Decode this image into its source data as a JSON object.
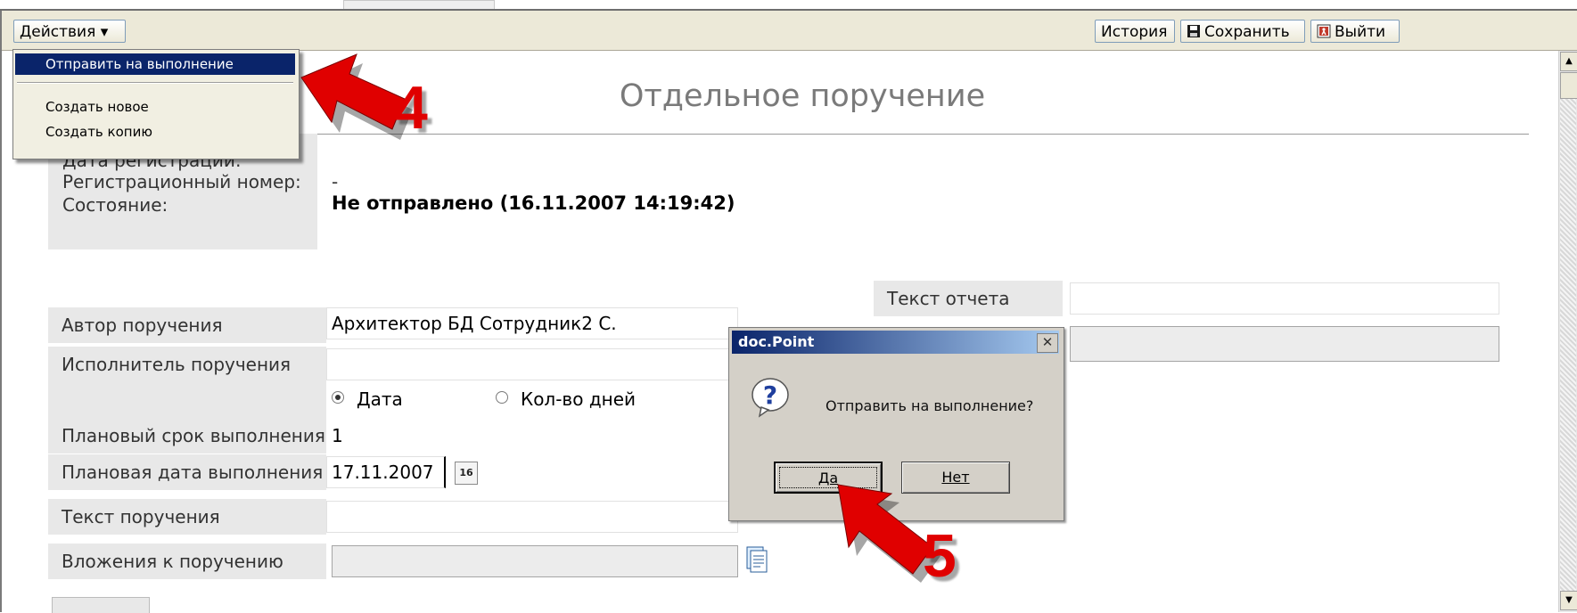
{
  "toolbar": {
    "actions_label": "Действия ▾",
    "history_label": "История",
    "save_label": "Сохранить",
    "exit_label": "Выйти"
  },
  "actions_menu": {
    "items": [
      "Отправить на выполнение",
      "Создать новое",
      "Создать копию"
    ]
  },
  "page": {
    "title": "Отдельное поручение"
  },
  "registration": {
    "date_label": "Дата регистрации:",
    "number_label": "Регистрационный номер:",
    "number_value": "-",
    "status_label": "Состояние:",
    "status_value": "Не отправлено (16.11.2007 14:19:42)"
  },
  "form": {
    "author_label": "Автор поручения",
    "author_value": "Архитектор БД Сотрудник2 С.",
    "executor_label": "Исполнитель поручения",
    "executor_value": "",
    "radio_date_label": "Дата",
    "radio_days_label": "Кол-во дней",
    "radio_selected": "Дата",
    "planned_term_label": "Плановый срок выполнения",
    "planned_term_value": "1",
    "planned_date_label": "Плановая дата выполнения",
    "planned_date_value": "17.11.2007",
    "calendar_icon_text": "16",
    "task_text_label": "Текст поручения",
    "task_text_value": "",
    "attachments_label": "Вложения к поручению",
    "report_text_label": "Текст отчета",
    "report_text_value": ""
  },
  "dialog": {
    "title": "doc.Point",
    "close_glyph": "✕",
    "message": "Отправить на выполнение?",
    "yes_label": "Да",
    "no_label": "Нет"
  },
  "annotations": {
    "step4": "4",
    "step5": "5"
  },
  "scrollbar": {
    "up_glyph": "▲",
    "down_glyph": "▼"
  },
  "icons": [
    "floppy-disk-icon",
    "exit-door-icon",
    "calendar-icon",
    "attachment-icon",
    "question-icon",
    "close-icon"
  ],
  "colors": {
    "toolbar_bg": "#ece9d8",
    "menu_selected": "#0a246a",
    "dialog_title_start": "#0a246a",
    "dialog_title_end": "#a6caf0",
    "label_bg": "#e8e8e8",
    "annotation_arrow": "#e00000"
  }
}
